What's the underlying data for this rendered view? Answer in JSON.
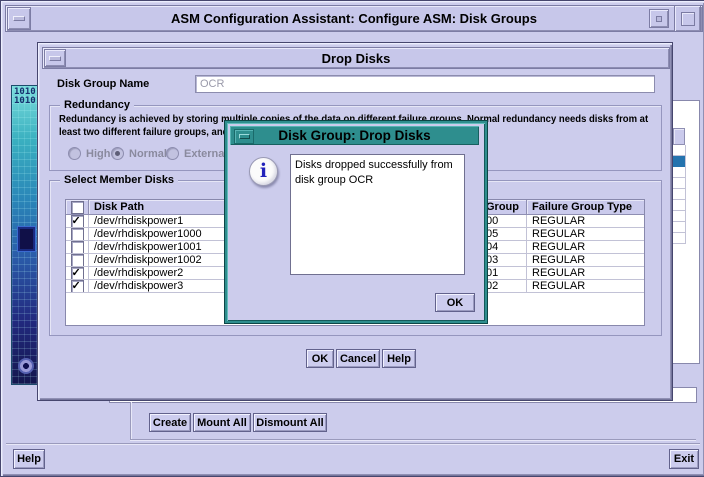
{
  "colors": {
    "background_lavender": "#ccccec",
    "accent_teal": "#2e8e8e",
    "selection_blue": "#2473ae",
    "info_icon_blue": "#2222bb",
    "disabled_text": "#8a8a9e"
  },
  "main_window": {
    "title": "ASM Configuration Assistant: Configure ASM: Disk Groups",
    "side_graphic_binary": "1010 1010",
    "buttons": {
      "create": "Create",
      "mount_all": "Mount All",
      "dismount_all": "Dismount All",
      "help": "Help",
      "exit": "Exit"
    }
  },
  "drop_disks_dialog": {
    "title": "Drop Disks",
    "disk_group_name": {
      "label": "Disk Group Name",
      "value": "OCR"
    },
    "redundancy": {
      "label": "Redundancy",
      "description_line1": "Redundancy is achieved by storing multiple copies of the data on different failure groups. Normal redundancy needs disks from at",
      "description_line2": "least two different failure groups, and",
      "options": [
        {
          "label": "High",
          "selected": false
        },
        {
          "label": "Normal",
          "selected": true
        },
        {
          "label": "External (Nor",
          "selected": false
        }
      ]
    },
    "member_disks": {
      "label": "Select Member Disks",
      "columns": [
        "",
        "Disk Path",
        "Group",
        "Failure Group Type"
      ],
      "rows": [
        {
          "checked": true,
          "disk_path": "/dev/rhdiskpower1",
          "group": "00",
          "failure_group_type": "REGULAR"
        },
        {
          "checked": false,
          "disk_path": "/dev/rhdiskpower1000",
          "group": "05",
          "failure_group_type": "REGULAR"
        },
        {
          "checked": false,
          "disk_path": "/dev/rhdiskpower1001",
          "group": "04",
          "failure_group_type": "REGULAR"
        },
        {
          "checked": false,
          "disk_path": "/dev/rhdiskpower1002",
          "group": "03",
          "failure_group_type": "REGULAR"
        },
        {
          "checked": true,
          "disk_path": "/dev/rhdiskpower2",
          "group": "01",
          "failure_group_type": "REGULAR"
        },
        {
          "checked": true,
          "disk_path": "/dev/rhdiskpower3",
          "group": "02",
          "failure_group_type": "REGULAR"
        }
      ]
    },
    "buttons": {
      "ok": "OK",
      "cancel": "Cancel",
      "help": "Help"
    }
  },
  "message_dialog": {
    "title": "Disk Group: Drop Disks",
    "icon": "info-icon",
    "message": "Disks dropped successfully from disk group OCR",
    "ok_label": "OK"
  }
}
